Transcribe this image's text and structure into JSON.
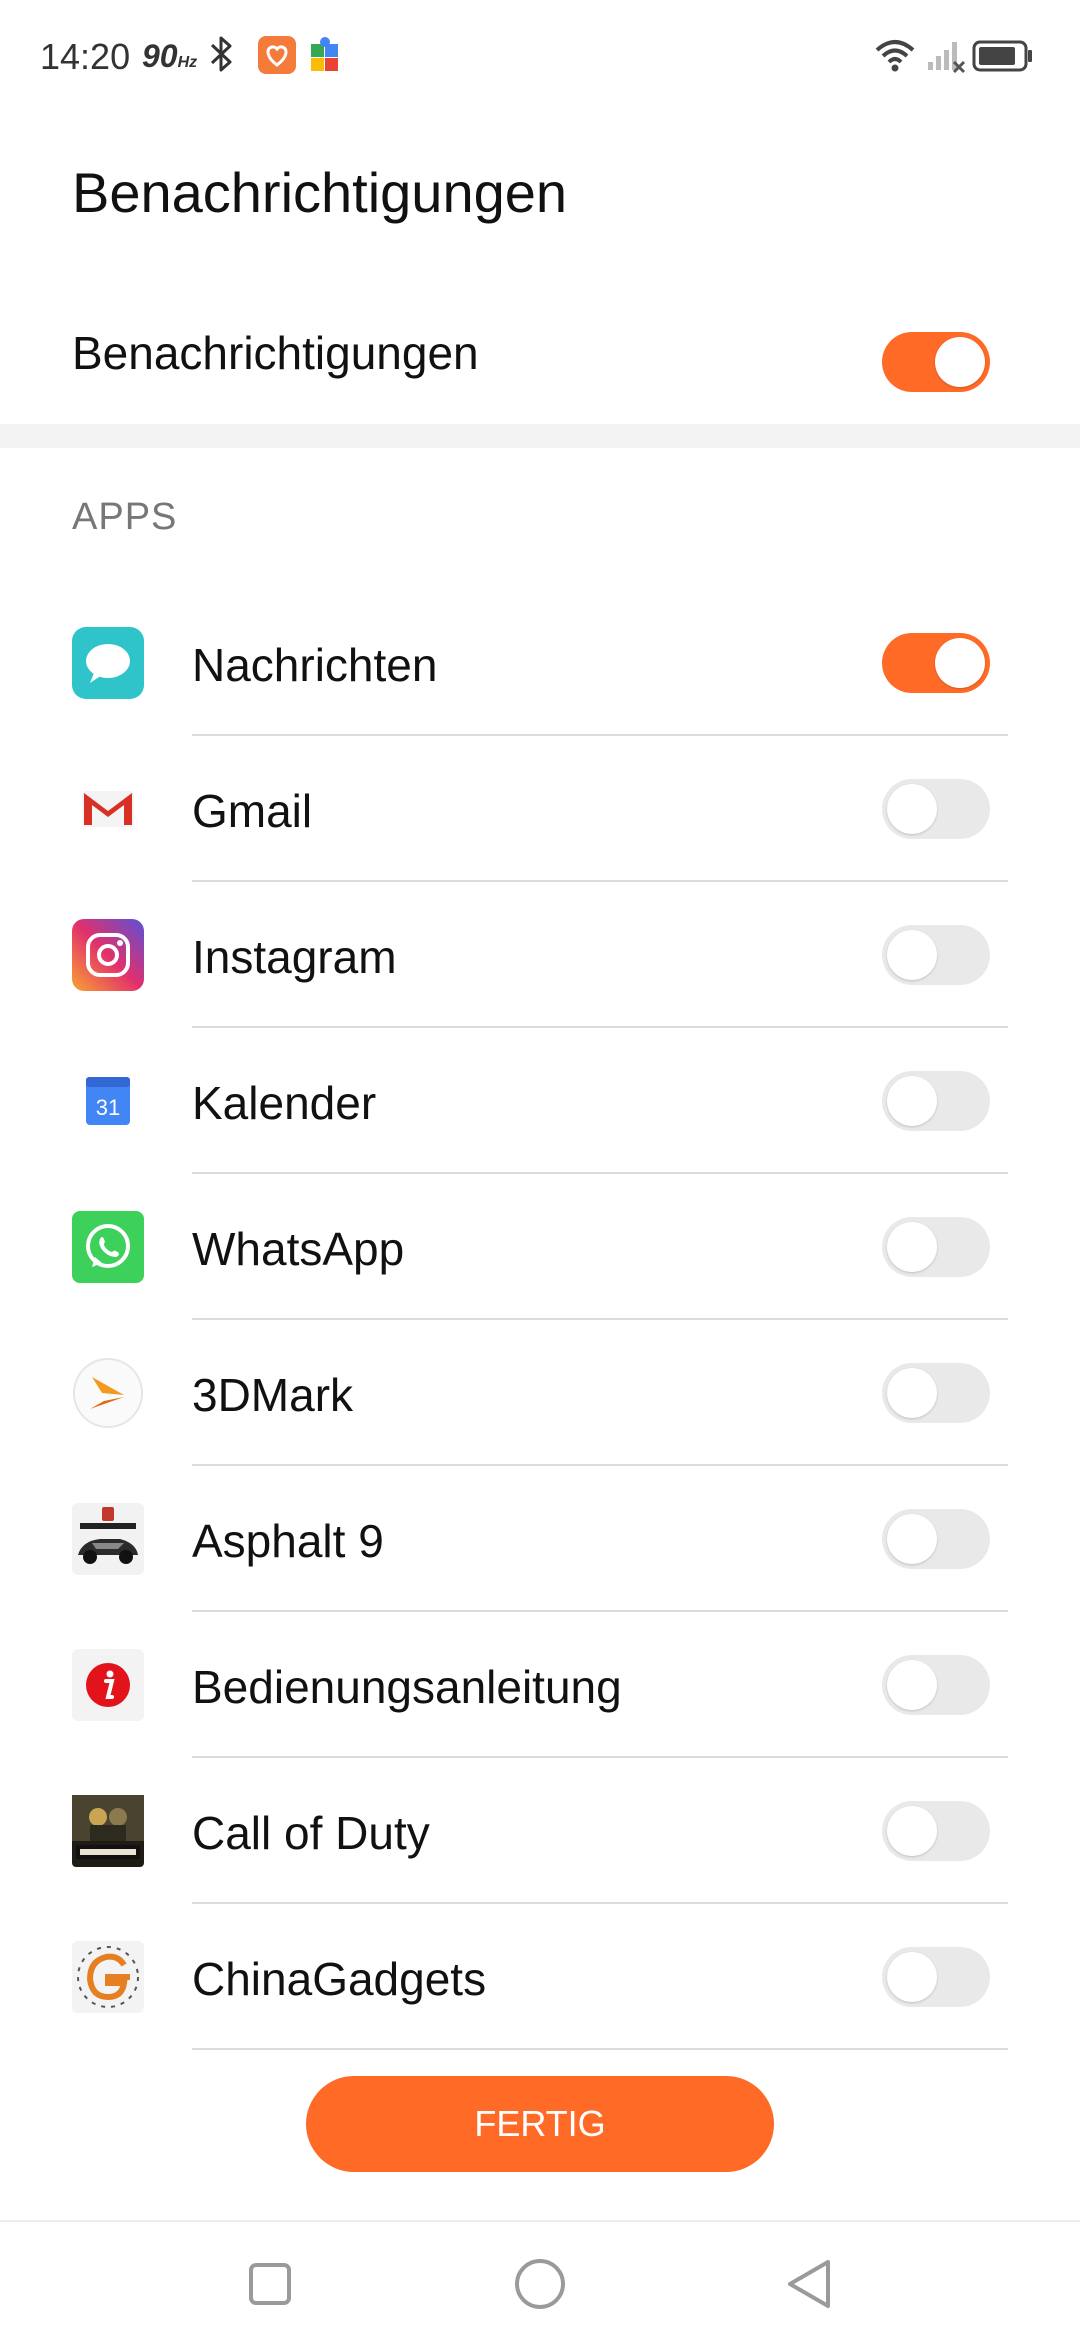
{
  "status_bar": {
    "time": "14:20",
    "refresh_rate": "90",
    "refresh_unit": "Hz"
  },
  "page": {
    "title": "Benachrichtigungen"
  },
  "master_toggle": {
    "label": "Benachrichtigungen",
    "enabled": true
  },
  "apps_section": {
    "header": "APPS",
    "items": [
      {
        "label": "Nachrichten",
        "icon": "messages-icon",
        "enabled": true
      },
      {
        "label": "Gmail",
        "icon": "gmail-icon",
        "enabled": false
      },
      {
        "label": "Instagram",
        "icon": "instagram-icon",
        "enabled": false
      },
      {
        "label": "Kalender",
        "icon": "calendar-icon",
        "icon_text": "31",
        "enabled": false
      },
      {
        "label": "WhatsApp",
        "icon": "whatsapp-icon",
        "enabled": false
      },
      {
        "label": "3DMark",
        "icon": "3dmark-icon",
        "enabled": false
      },
      {
        "label": "Asphalt 9",
        "icon": "asphalt-icon",
        "enabled": false
      },
      {
        "label": "Bedienungsanleitung",
        "icon": "manual-icon",
        "enabled": false
      },
      {
        "label": "Call of Duty",
        "icon": "call-of-duty-icon",
        "enabled": false
      },
      {
        "label": "ChinaGadgets",
        "icon": "chinagadgets-icon",
        "enabled": false
      },
      {
        "label": "",
        "icon": "partial-app-icon",
        "enabled": false
      }
    ]
  },
  "done_button": {
    "label": "FERTIG"
  },
  "colors": {
    "accent": "#ff6a26",
    "toggle_off": "#e9e9e9",
    "divider": "#dcdcdc"
  }
}
